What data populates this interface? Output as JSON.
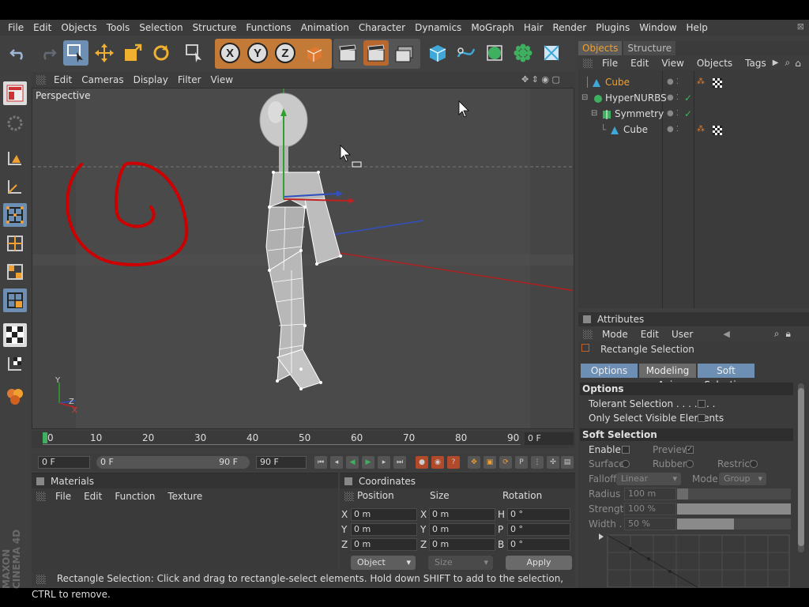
{
  "menu": [
    "File",
    "Edit",
    "Objects",
    "Tools",
    "Selection",
    "Structure",
    "Functions",
    "Animation",
    "Character",
    "Dynamics",
    "MoGraph",
    "Hair",
    "Render",
    "Plugins",
    "Window",
    "Help"
  ],
  "viewport": {
    "menu": [
      "Edit",
      "Cameras",
      "Display",
      "Filter",
      "View"
    ],
    "label": "Perspective",
    "axis_labels": {
      "y": "Y",
      "z": "Z",
      "x": "X"
    }
  },
  "timeline": {
    "ticks": [
      "0",
      "10",
      "20",
      "30",
      "40",
      "50",
      "60",
      "70",
      "80",
      "90"
    ],
    "current_frame": "0 F"
  },
  "transport": {
    "start": "0 F",
    "range_start": "0 F",
    "range_end": "90 F",
    "end": "90 F"
  },
  "materials": {
    "title": "Materials",
    "menu": [
      "File",
      "Edit",
      "Function",
      "Texture"
    ]
  },
  "coordinates": {
    "title": "Coordinates",
    "headers": [
      "Position",
      "Size",
      "Rotation"
    ],
    "rows": [
      {
        "pl": "X",
        "pv": "0 m",
        "sl": "X",
        "sv": "0 m",
        "rl": "H",
        "rv": "0 °"
      },
      {
        "pl": "Y",
        "pv": "0 m",
        "sl": "Y",
        "sv": "0 m",
        "rl": "P",
        "rv": "0 °"
      },
      {
        "pl": "Z",
        "pv": "0 m",
        "sl": "Z",
        "sv": "0 m",
        "rl": "B",
        "rv": "0 °"
      }
    ],
    "mode": "Object",
    "size_mode": "Size",
    "apply": "Apply"
  },
  "status": "Rectangle Selection: Click and drag to rectangle-select elements. Hold down SHIFT to add to the selection, CTRL to remove.",
  "objects": {
    "tabs": [
      "Objects",
      "Structure"
    ],
    "menu": [
      "File",
      "Edit",
      "View",
      "Objects",
      "Tags"
    ],
    "tree": [
      {
        "name": "Cube",
        "indent": 0,
        "selected": true
      },
      {
        "name": "HyperNURBS",
        "indent": 0,
        "selected": false
      },
      {
        "name": "Symmetry",
        "indent": 1,
        "selected": false
      },
      {
        "name": "Cube",
        "indent": 2,
        "selected": false
      }
    ]
  },
  "attributes": {
    "title": "Attributes",
    "menu": [
      "Mode",
      "Edit",
      "User"
    ],
    "tool": "Rectangle Selection",
    "tabs": [
      "Options",
      "Modeling Axis",
      "Soft Selection"
    ],
    "options_title": "Options",
    "tolerant": "Tolerant Selection . . . . . . .",
    "visible_only": "Only Select Visible Elements",
    "soft_title": "Soft Selection",
    "enable": "Enable",
    "preview": "Preview",
    "surface": "Surface",
    "rubber": "Rubber",
    "restrict": "Restrict",
    "falloff_label": "Falloff",
    "falloff_value": "Linear",
    "mode_label": "Mode",
    "mode_value": "Group",
    "radius_label": "Radius",
    "radius_value": "100 m",
    "strength_label": "Strength",
    "strength_value": "100 %",
    "width_label": "Width . .",
    "width_value": "50 %"
  },
  "brand": "MAXON CINEMA 4D",
  "colors": {
    "accent": "#6d8fb3",
    "orange": "#f0a030",
    "red_scribble": "#cc0000"
  }
}
